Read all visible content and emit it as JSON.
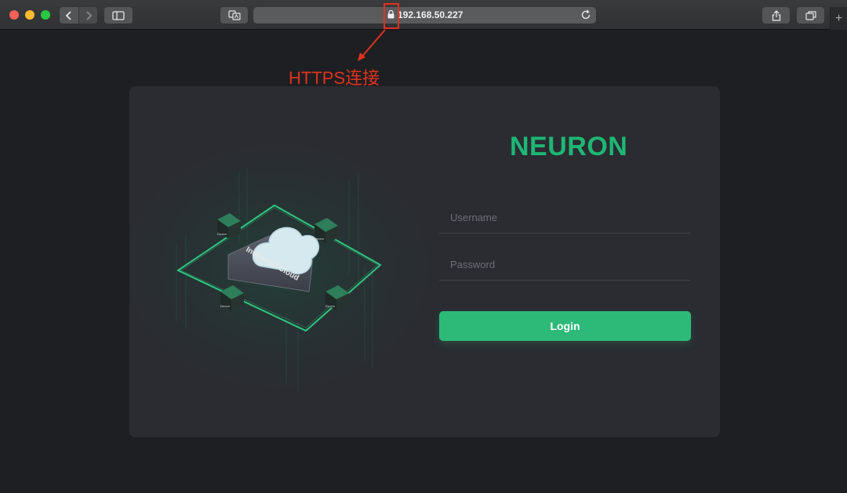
{
  "browser": {
    "url": "192.168.50.227",
    "new_tab_label": "+"
  },
  "annotation": {
    "text": "HTTPS连接",
    "color": "#e0321e"
  },
  "login": {
    "brand": "NEURON",
    "brand_color": "#1eb774",
    "username_placeholder": "Username",
    "password_placeholder": "Password",
    "login_label": "Login",
    "accent": "#2dba78"
  },
  "illustration": {
    "cloud_label": "Industrial Cloud",
    "device_label": "Device"
  }
}
